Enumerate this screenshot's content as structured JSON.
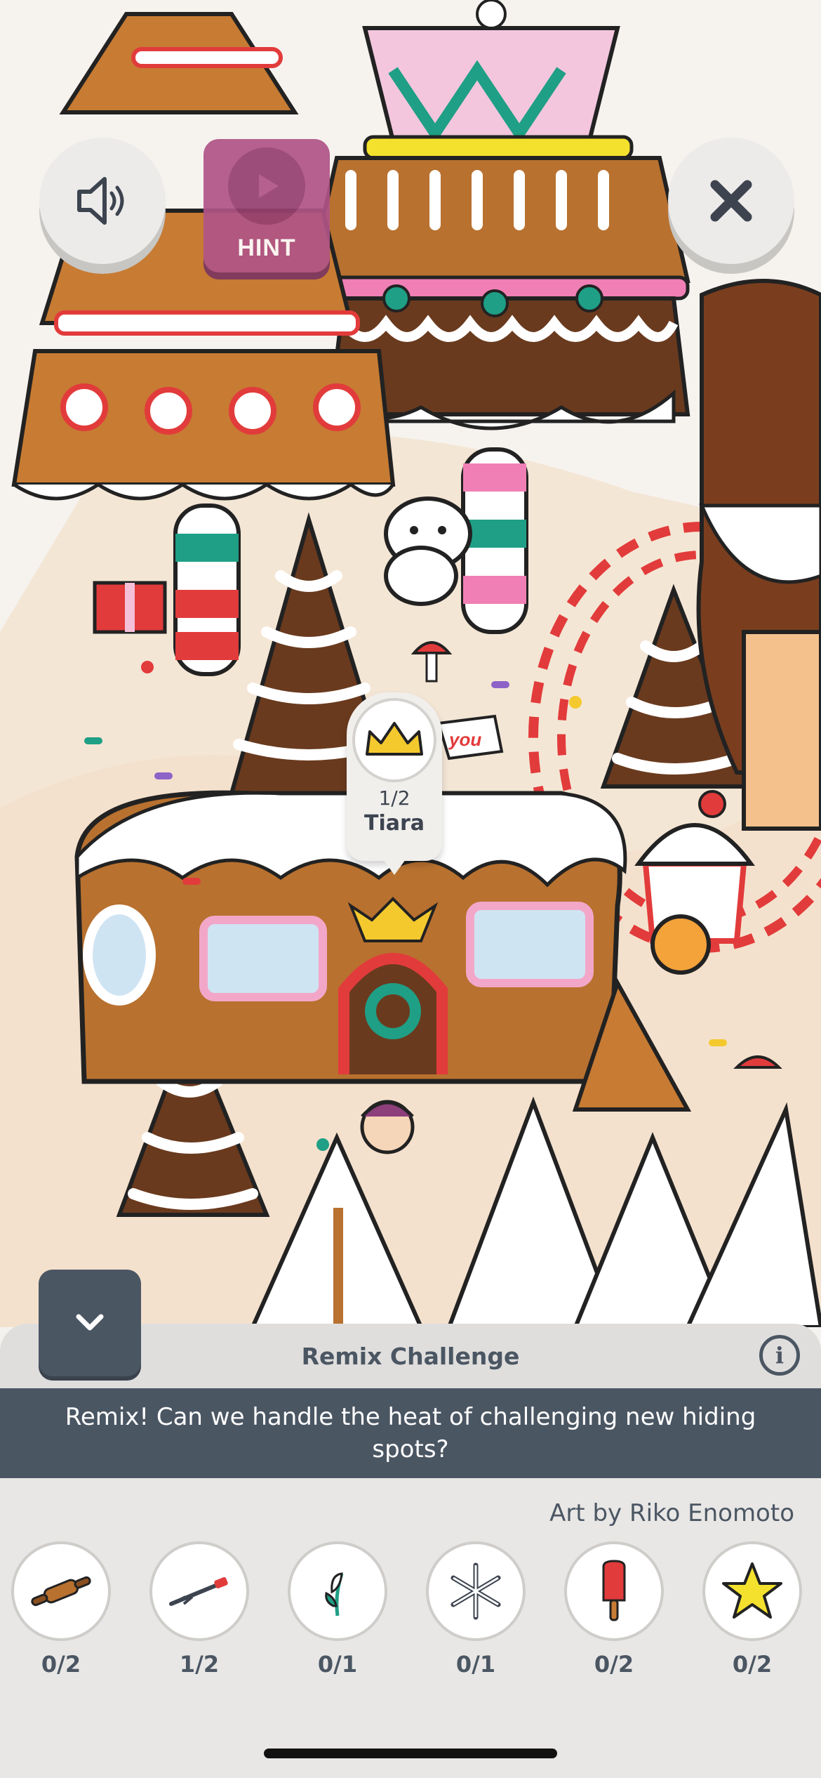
{
  "hud": {
    "hint_label": "HINT",
    "sound_icon": "speaker-icon",
    "close_icon": "close-icon"
  },
  "found_callout": {
    "count": "1/2",
    "name": "Tiara",
    "icon": "tiara-icon"
  },
  "scene_labels": {
    "you_flag": "you"
  },
  "panel": {
    "title": "Remix Challenge",
    "banner": "Remix! Can we handle the heat of challenging new hiding spots?",
    "credit": "Art by Riko Enomoto",
    "items": [
      {
        "icon": "rolling-pin-icon",
        "count": "0/2"
      },
      {
        "icon": "tiara-icon",
        "count": "1/2"
      },
      {
        "icon": "snowdrop-flower-icon",
        "count": "0/1"
      },
      {
        "icon": "snowflake-icon",
        "count": "0/1"
      },
      {
        "icon": "popsicle-icon",
        "count": "0/2"
      },
      {
        "icon": "star-icon",
        "count": "0/2"
      }
    ]
  },
  "colors": {
    "panel_dark": "#4b5663",
    "hint_button": "#b05487",
    "gingerbread": "#b8712f",
    "candy_red": "#e23b3b",
    "mint": "#1f9f85"
  }
}
